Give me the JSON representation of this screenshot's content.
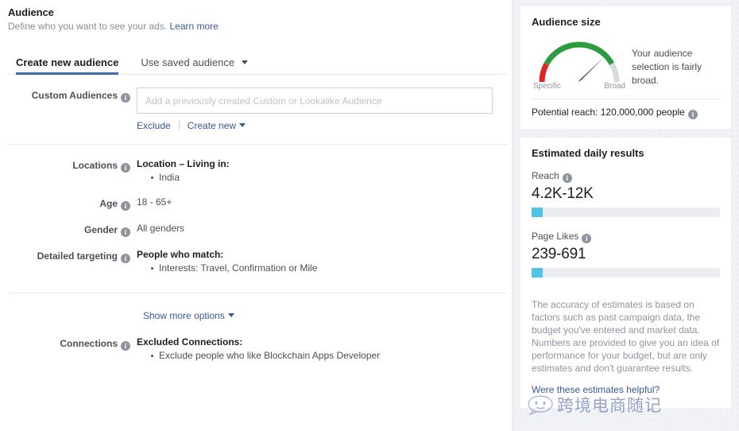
{
  "page": {
    "title": "Audience",
    "subtitle": "Define who you want to see your ads.",
    "learn_more": "Learn more"
  },
  "tabs": [
    {
      "label": "Create new audience",
      "active": true
    },
    {
      "label": "Use saved audience",
      "active": false,
      "has_caret": true
    }
  ],
  "form": {
    "custom_audiences": {
      "label": "Custom Audiences",
      "placeholder": "Add a previously created Custom or Lookalike Audience",
      "value": "",
      "exclude_link": "Exclude",
      "create_new_link": "Create new"
    },
    "locations": {
      "label": "Locations",
      "heading": "Location – Living in:",
      "items": [
        "India"
      ]
    },
    "age": {
      "label": "Age",
      "value": "18 - 65+"
    },
    "gender": {
      "label": "Gender",
      "value": "All genders"
    },
    "detailed_targeting": {
      "label": "Detailed targeting",
      "heading": "People who match:",
      "items": [
        "Interests: Travel, Confirmation or Mile"
      ]
    },
    "show_more_options": "Show more options",
    "connections": {
      "label": "Connections",
      "heading": "Excluded Connections:",
      "items": [
        "Exclude people who like Blockchain Apps Developer"
      ]
    }
  },
  "audience_size": {
    "title": "Audience size",
    "gauge_min_label": "Specific",
    "gauge_max_label": "Broad",
    "message": "Your audience selection is fairly broad.",
    "potential_reach_label": "Potential reach:",
    "potential_reach_value": "120,000,000",
    "potential_reach_unit": "people",
    "needle_angle_deg": 58,
    "colors": {
      "specific": "#e02424",
      "mid": "#2e9b3f",
      "broad": "#d8dadf",
      "needle": "#222222"
    }
  },
  "estimated_results": {
    "title": "Estimated daily results",
    "metrics": [
      {
        "label": "Reach",
        "value": "4.2K-12K",
        "bar_percent": 6
      },
      {
        "label": "Page Likes",
        "value": "239-691",
        "bar_percent": 6
      }
    ],
    "disclaimer": "The accuracy of estimates is based on factors such as past campaign data, the budget you've entered and market data. Numbers are provided to give you an idea of performance for your budget, but are only estimates and don't guarantee results.",
    "helpful_link": "Were these estimates helpful?",
    "bar_color": "#4fc3e8"
  },
  "watermark": {
    "text": "跨境电商随记"
  },
  "icons": {
    "info": "i"
  }
}
